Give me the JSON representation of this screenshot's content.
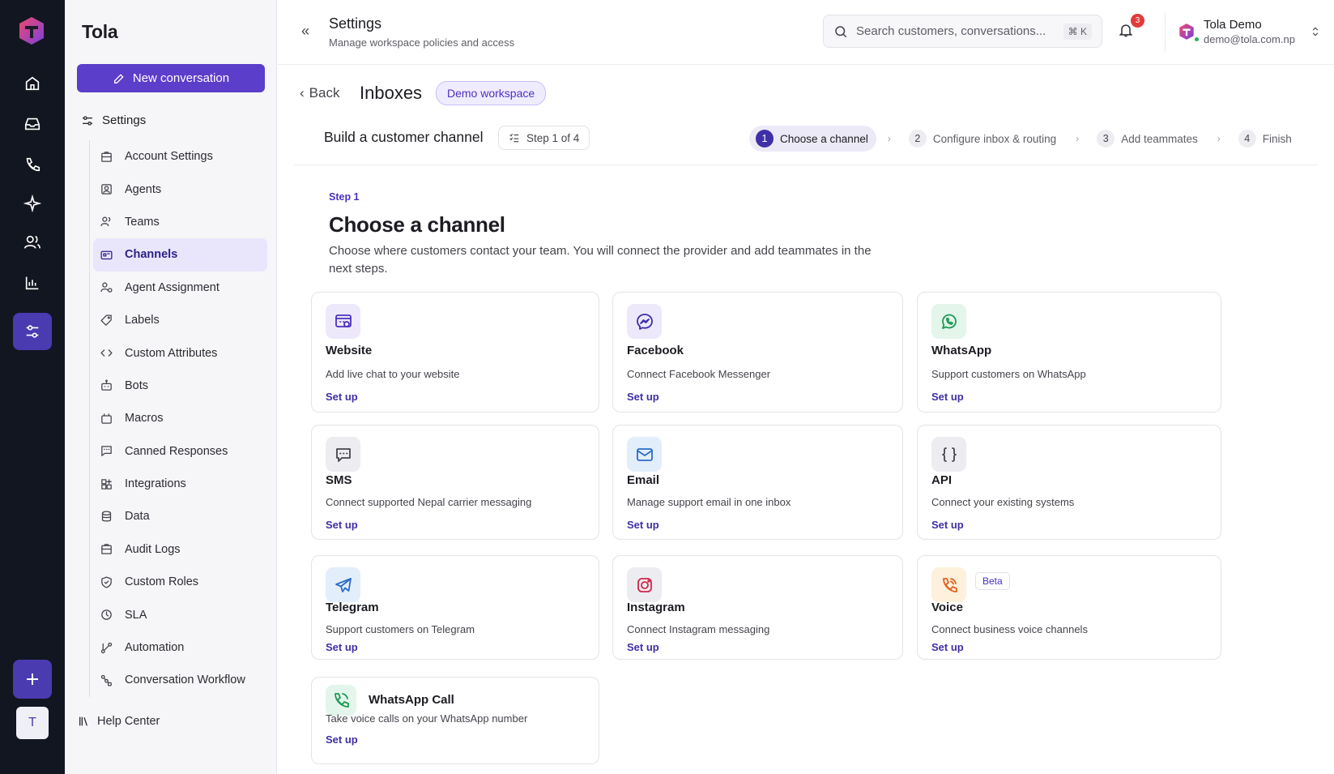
{
  "app": {
    "brand": "Tola",
    "rail_avatar": "T"
  },
  "sidebar": {
    "new_conversation": "New conversation",
    "settings_heading": "Settings",
    "items": [
      {
        "label": "Account Settings",
        "icon": "building-icon"
      },
      {
        "label": "Agents",
        "icon": "agent-icon"
      },
      {
        "label": "Teams",
        "icon": "teams-icon"
      },
      {
        "label": "Channels",
        "icon": "channels-icon",
        "active": true
      },
      {
        "label": "Agent Assignment",
        "icon": "assignment-icon"
      },
      {
        "label": "Labels",
        "icon": "tag-icon"
      },
      {
        "label": "Custom Attributes",
        "icon": "code-icon"
      },
      {
        "label": "Bots",
        "icon": "bot-icon"
      },
      {
        "label": "Macros",
        "icon": "macro-icon"
      },
      {
        "label": "Canned Responses",
        "icon": "message-square-icon"
      },
      {
        "label": "Integrations",
        "icon": "integrations-icon"
      },
      {
        "label": "Data",
        "icon": "database-icon"
      },
      {
        "label": "Audit Logs",
        "icon": "audit-icon"
      },
      {
        "label": "Custom Roles",
        "icon": "shield-icon"
      },
      {
        "label": "SLA",
        "icon": "clock-icon"
      },
      {
        "label": "Automation",
        "icon": "automation-icon"
      },
      {
        "label": "Conversation Workflow",
        "icon": "workflow-icon"
      }
    ],
    "help": "Help Center"
  },
  "header": {
    "title": "Settings",
    "subtitle": "Manage workspace policies and access",
    "search_placeholder": "Search customers, conversations...",
    "search_shortcut": "⌘ K",
    "notification_count": "3",
    "user_name": "Tola Demo",
    "user_email": "demo@tola.com.np"
  },
  "main": {
    "back": "Back",
    "title": "Inboxes",
    "workspace_badge": "Demo workspace",
    "build_title": "Build a customer channel",
    "step_pill": "Step 1 of 4",
    "steps": [
      {
        "num": "1",
        "label": "Choose a channel",
        "active": true
      },
      {
        "num": "2",
        "label": "Configure inbox & routing"
      },
      {
        "num": "3",
        "label": "Add teammates"
      },
      {
        "num": "4",
        "label": "Finish"
      }
    ],
    "step_label": "Step 1",
    "heading": "Choose a channel",
    "description": "Choose where customers contact your team. You will connect the provider and add teammates in the next steps."
  },
  "channels": [
    {
      "name": "Website",
      "desc": "Add live chat to your website",
      "setup": "Set up",
      "icon": "website-chat-icon",
      "tint": "#ede9fb",
      "color": "#4b31bf"
    },
    {
      "name": "Facebook",
      "desc": "Connect Facebook Messenger",
      "setup": "Set up",
      "icon": "messenger-icon",
      "tint": "#ede9fb",
      "color": "#3f2fa8"
    },
    {
      "name": "WhatsApp",
      "desc": "Support customers on WhatsApp",
      "setup": "Set up",
      "icon": "whatsapp-icon",
      "tint": "#e4f5ec",
      "color": "#1f9a55"
    },
    {
      "name": "SMS",
      "desc": "Connect supported Nepal carrier messaging",
      "setup": "Set up",
      "icon": "sms-icon",
      "tint": "#ededf1",
      "color": "#44444c"
    },
    {
      "name": "Email",
      "desc": "Manage support email in one inbox",
      "setup": "Set up",
      "icon": "mail-icon",
      "tint": "#e3eefb",
      "color": "#2b6cc4"
    },
    {
      "name": "API",
      "desc": "Connect your existing systems",
      "setup": "Set up",
      "icon": "braces-icon",
      "tint": "#ededf1",
      "color": "#44444c"
    },
    {
      "name": "Telegram",
      "desc": "Support customers on Telegram",
      "setup": "Set up",
      "icon": "telegram-icon",
      "tint": "#e3eefb",
      "color": "#2b6cc4"
    },
    {
      "name": "Instagram",
      "desc": "Connect Instagram messaging",
      "setup": "Set up",
      "icon": "instagram-icon",
      "tint": "#ededf1",
      "color": "#d2264b"
    },
    {
      "name": "Voice",
      "desc": "Connect business voice channels",
      "setup": "Set up",
      "icon": "phone-icon",
      "tint": "#fdf1dc",
      "color": "#e0631f",
      "badge": "Beta"
    },
    {
      "name": "WhatsApp Call",
      "desc": "Take voice calls on your WhatsApp number",
      "setup": "Set up",
      "icon": "phone-call-icon",
      "tint": "#e4f5ec",
      "color": "#1f9a55"
    }
  ]
}
